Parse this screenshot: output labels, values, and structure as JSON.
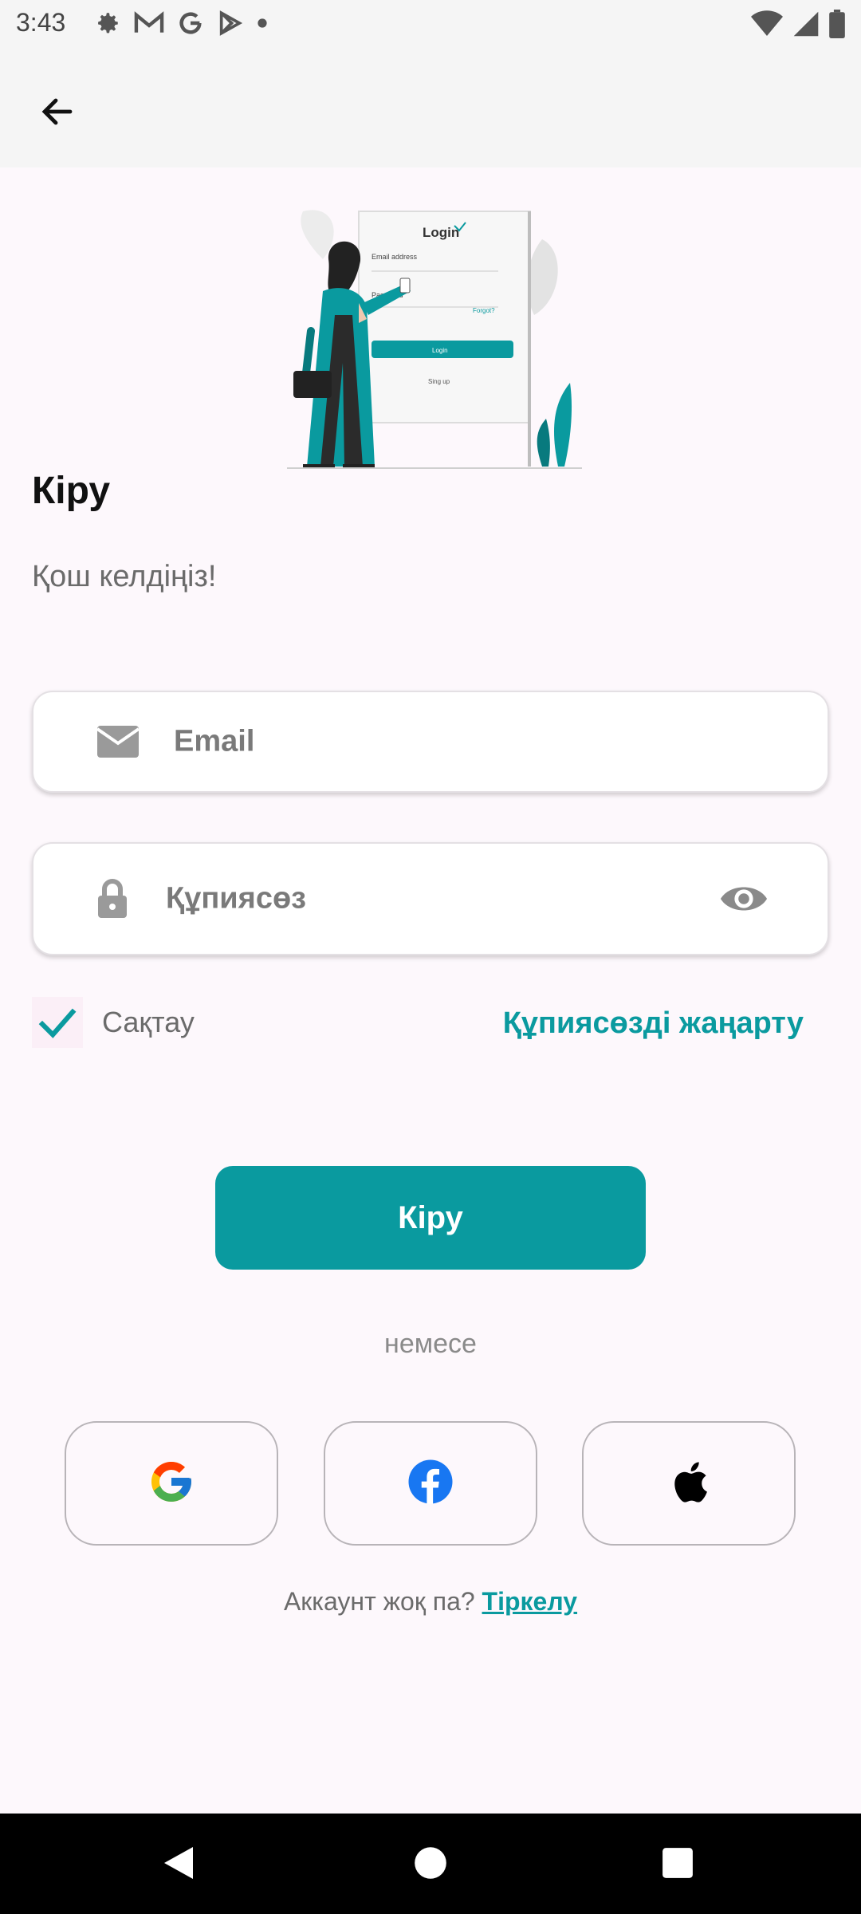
{
  "status_bar": {
    "time": "3:43",
    "left_icons": [
      "settings-icon",
      "gmail-icon",
      "google-icon",
      "play-store-icon",
      "dot-icon"
    ],
    "right_icons": [
      "wifi-icon",
      "signal-icon",
      "battery-icon"
    ]
  },
  "app_bar": {
    "back_icon": "arrow-left-icon"
  },
  "illustration": {
    "card_title": "Login",
    "email_label": "Email address",
    "password_label": "Password",
    "forgot_label": "Forgot?",
    "button_label": "Login",
    "signup_label": "Sing up"
  },
  "header": {
    "title": "Кіру",
    "subtitle": "Қош келдіңіз!"
  },
  "form": {
    "email_placeholder": "Email",
    "password_placeholder": "Құпиясөз",
    "remember_label": "Сақтау",
    "remember_checked": true,
    "reset_password_label": "Құпиясөзді жаңарту"
  },
  "actions": {
    "login_label": "Кіру",
    "or_label": "немесе"
  },
  "social": [
    {
      "name": "google",
      "icon": "google-logo-icon"
    },
    {
      "name": "facebook",
      "icon": "facebook-logo-icon"
    },
    {
      "name": "apple",
      "icon": "apple-logo-icon"
    }
  ],
  "signup": {
    "prompt": "Аккаунт жоқ па?",
    "link": "Тіркелу"
  },
  "colors": {
    "accent": "#0a9a9f",
    "background": "#fdf8fc"
  }
}
